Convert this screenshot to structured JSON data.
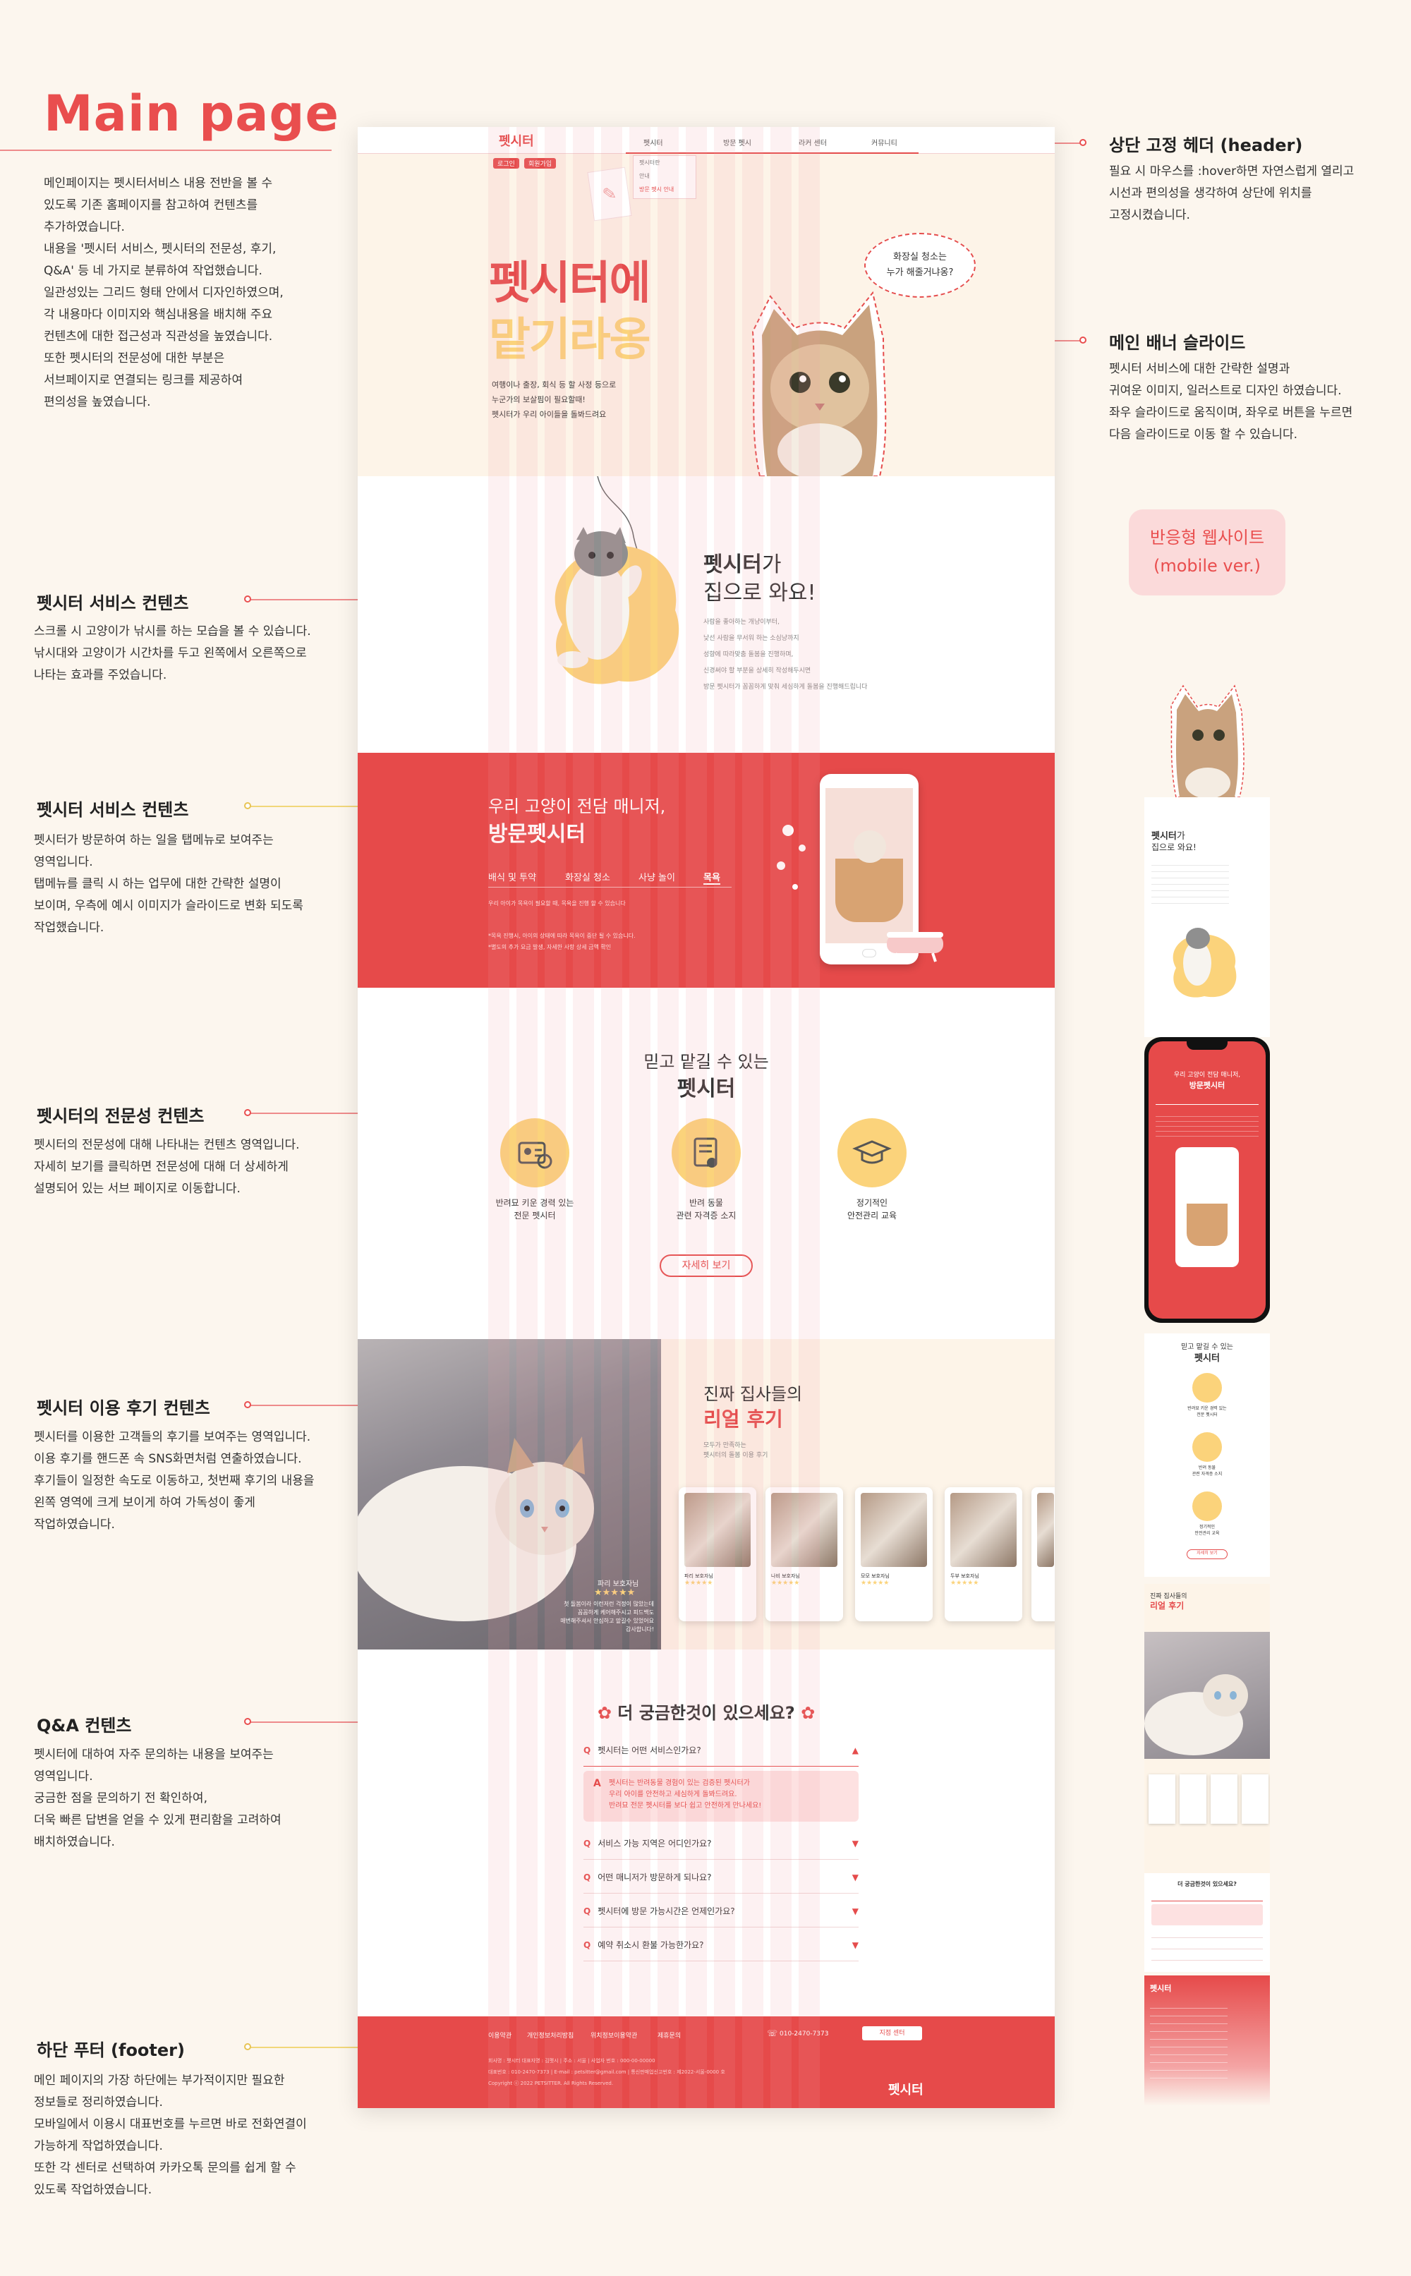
{
  "page_title": "Main page",
  "intro": "메인페이지는 펫시터서비스 내용 전반을 볼 수\n있도록 기존 홈페이지를 참고하여 컨텐츠를\n추가하였습니다.\n내용을 '펫시터 서비스, 펫시터의 전문성, 후기,\nQ&A' 등 네 가지로 분류하여 작업했습니다.\n일관성있는 그리드 형태 안에서 디자인하였으며,\n각 내용마다 이미지와 핵심내용을 배치해 주요\n컨텐츠에 대한 접근성과 직관성을 높였습니다.\n또한 펫시터의 전문성에 대한 부분은\n서브페이지로 연결되는 링크를 제공하여\n편의성을 높였습니다.",
  "left_notes": [
    {
      "title": "펫시터 서비스 컨텐츠",
      "body": "스크롤 시 고양이가 낚시를 하는 모습을 볼 수 있습니다.\n낚시대와 고양이가 시간차를 두고 왼쪽에서 오른쪽으로\n나타는 효과를 주었습니다."
    },
    {
      "title": "펫시터 서비스 컨텐츠",
      "body": "펫시터가 방문하여 하는 일을 탭메뉴로 보여주는\n영역입니다.\n탭메뉴를 클릭 시 하는 업무에 대한 간략한 설명이\n보이며, 우측에 예시 이미지가 슬라이드로 변화 되도록\n작업했습니다."
    },
    {
      "title": "펫시터의 전문성 컨텐츠",
      "body": "펫시터의 전문성에 대해 나타내는 컨텐츠 영역입니다.\n자세히 보기를 클릭하면 전문성에 대해 더 상세하게\n설명되어 있는 서브 페이지로 이동합니다."
    },
    {
      "title": "펫시터 이용 후기 컨텐츠",
      "body": "펫시터를 이용한 고객들의 후기를 보여주는 영역입니다.\n이용 후기를 핸드폰 속 SNS화면처럼 연출하였습니다.\n후기들이 일정한 속도로 이동하고, 첫번째 후기의 내용을\n왼쪽 영역에 크게 보이게 하여 가독성이 좋게\n작업하였습니다."
    },
    {
      "title": "Q&A 컨텐츠",
      "body": "펫시터에 대하여 자주 문의하는 내용을 보여주는\n영역입니다.\n궁금한 점을 문의하기 전 확인하여,\n더욱 빠른 답변을 얻을 수 있게 편리함을 고려하여\n배치하였습니다."
    },
    {
      "title": "하단 푸터 (footer)",
      "body": "메인 페이지의 가장 하단에는 부가적이지만 필요한\n정보들로 정리하였습니다.\n모바일에서 이용시 대표번호를 누르면 바로 전화연결이\n가능하게 작업하였습니다.\n또한 각 센터로 선택하여 카카오톡 문의를 쉽게 할 수\n있도록 작업하였습니다."
    }
  ],
  "right_notes": [
    {
      "title": "상단 고정 헤더 (header)",
      "body": "필요 시 마우스를 :hover하면 자연스럽게 열리고\n시선과 편의성을 생각하여 상단에 위치를\n고정시켰습니다."
    },
    {
      "title": "메인 배너 슬라이드",
      "body": "펫시터 서비스에 대한 간략한 설명과\n귀여운 이미지, 일러스트로 디자인 하였습니다.\n좌우 슬라이드로 움직이며, 좌우로 버튼을 누르면\n다음 슬라이드로 이동 할 수 있습니다."
    }
  ],
  "responsive_badge": "반응형 웹사이트\n(mobile ver.)",
  "header": {
    "logo": "펫시터",
    "tags": [
      "로그인",
      "회원가입"
    ],
    "nav": [
      "펫시터",
      "방문 펫시",
      "라커 센터",
      "커뮤니티"
    ],
    "dropdown": [
      "펫시터란",
      "안내",
      "방문 펫시 안내"
    ]
  },
  "banner": {
    "bubble": "화장실 청소는\n누가 해줄거냐옹?",
    "title_line1": "펫시터에",
    "title_line2": "맡기라옹",
    "desc": "여행이나 출장, 회식 등 할 사정 등으로\n누군가의 보살핌이 필요할때!\n펫시터가 우리 아이들을 돌봐드려요"
  },
  "service": {
    "title_bold": "펫시터",
    "title_rest": "가",
    "subtitle": "집으로 와요!",
    "desc": "사람을 좋아하는 개냥이부터,\n낯선 사람을 무서워 하는 소심냥까지\n성향에 따라맞춤 돌봄을 진행하며,\n신경써야 할 부분을 상세히 작성해두시면\n방문 펫시터가 꼼꼼하게 맞춰 세심하게 돌봄을 진행해드립니다"
  },
  "visit": {
    "subtitle": "우리 고양이 전담 매니저,",
    "title": "방문펫시터",
    "tabs": [
      "배식 및 투약",
      "화장실 청소",
      "사냥 놀이",
      "목욕"
    ],
    "active_tab": 3,
    "desc1": "우리 아이가 목욕이 필요할 때, 목욕을 진행 할 수 있습니다",
    "desc2": "*목욕 진행시, 아이의 상태에 따라 목욕이 중단 될 수 있습니다.\n*별도의 추가 요금 발생, 자세한 사항 상세 금액 확인"
  },
  "expert": {
    "subtitle": "믿고 맡길 수 있는",
    "title": "펫시터",
    "items": [
      {
        "icon": "id-card-icon",
        "label": "반려묘 키운 경력 있는\n전문 펫시터"
      },
      {
        "icon": "certificate-scroll-icon",
        "label": "반려 동물\n관련 자격증 소지"
      },
      {
        "icon": "graduation-cap-icon",
        "label": "정기적인\n안전관리 교육"
      }
    ],
    "button": "자세히 보기"
  },
  "review": {
    "subtitle": "진짜 집사들의",
    "title": "리얼 후기",
    "desc": "모두가 만족하는\n펫시터의 돌봄 이용 후기",
    "featured_name": "파리 보호자님",
    "featured_stars": "★★★★★",
    "featured_text": "첫 돌봄이라 이런저런 걱정이 많았는데\n꼼꼼하게 케어해주시고 피드백도\n매번해주셔서 안심하고 맡길수 있었어요\n감사합니다!",
    "card_stars": "★★★★★",
    "cards": [
      {
        "name": "파리 보호자님"
      },
      {
        "name": "나비 보호자님"
      },
      {
        "name": "모모 보호자님"
      },
      {
        "name": "두부 보호자님"
      }
    ]
  },
  "faq": {
    "title": "더 궁금한것이 있으세요?",
    "open_question": "펫시터는 어떤 서비스인가요?",
    "answer": "펫시터는 반려동물 경험이 있는 검증된 펫시터가\n우리 아이를 안전하고 세심하게 돌봐드려요.\n반려묘 전문 펫시터를 보다 쉽고 안전하게 만나세요!",
    "questions": [
      "서비스 가능 지역은 어디인가요?",
      "어떤 매니저가 방문하게 되나요?",
      "펫시터에 방문 가능시간은 언제인가요?",
      "예약 취소시 환불 가능한가요?"
    ]
  },
  "footer": {
    "links": [
      "이용약관",
      "개인정보처리방침",
      "위치정보이용약관",
      "제휴문의"
    ],
    "phone": "010-2470-7373",
    "center_button": "지점 센터",
    "info": "회사명 : 펫시터 대표자명 : 김펫시 | 주소 : 서울 | 사업자 번호 : 000-00-00000\n대표번호 : 010-2470-7373 | E-mail : petsitter@gmail.com | 통신판매업신고번호 : 제2022-서울-0000 호\nCopyright ⓒ 2022 PETSITTER. All Rights Reserved.",
    "logo": "펫시터"
  },
  "mobile": {
    "service_title_bold": "펫시터",
    "service_title_rest": "가",
    "service_subtitle": "집으로 와요!",
    "visit_subtitle": "우리 고양이 전담 매니저,",
    "visit_title": "방문펫시터",
    "expert_subtitle": "믿고 맡길 수 있는",
    "expert_title": "펫시터",
    "expert_items": [
      "반려묘 키운 경력 있는\n전문 펫시터",
      "반려 동물\n관련 자격증 소지",
      "정기적인\n안전관리 교육"
    ],
    "button": "자세히 보기",
    "review_subtitle": "진짜 집사들의",
    "review_title": "리얼 후기",
    "faq_title": "더 궁금한것이 있으세요?",
    "footer_logo": "펫시터"
  }
}
